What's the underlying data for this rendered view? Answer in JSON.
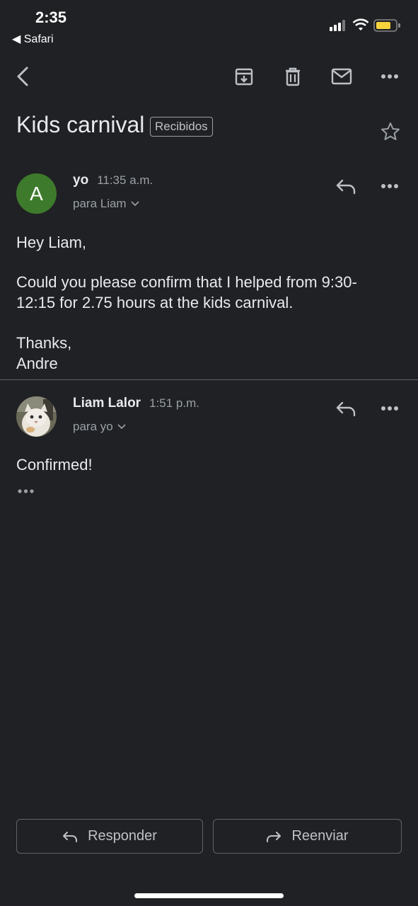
{
  "status_bar": {
    "time": "2:35",
    "back_app": "◀ Safari"
  },
  "thread": {
    "subject": "Kids carnival",
    "label": "Recibidos"
  },
  "messages": [
    {
      "avatar_letter": "A",
      "avatar_color": "#3e7a2c",
      "sender": "yo",
      "time": "11:35 a.m.",
      "to": "para Liam",
      "body": {
        "greeting": "Hey Liam,",
        "line1": "Could you please confirm that I helped from 9:30-",
        "line2": "12:15 for 2.75 hours at the kids carnival.",
        "closing": "Thanks,",
        "signature": "Andre"
      }
    },
    {
      "sender": "Liam Lalor",
      "time": "1:51 p.m.",
      "to": "para yo",
      "body": {
        "text": "Confirmed!"
      }
    }
  ],
  "actions": {
    "reply": "Responder",
    "forward": "Reenviar"
  },
  "colors": {
    "background": "#202124",
    "text": "#e8eaed",
    "muted": "#9aa0a6",
    "border": "#5f6368"
  }
}
